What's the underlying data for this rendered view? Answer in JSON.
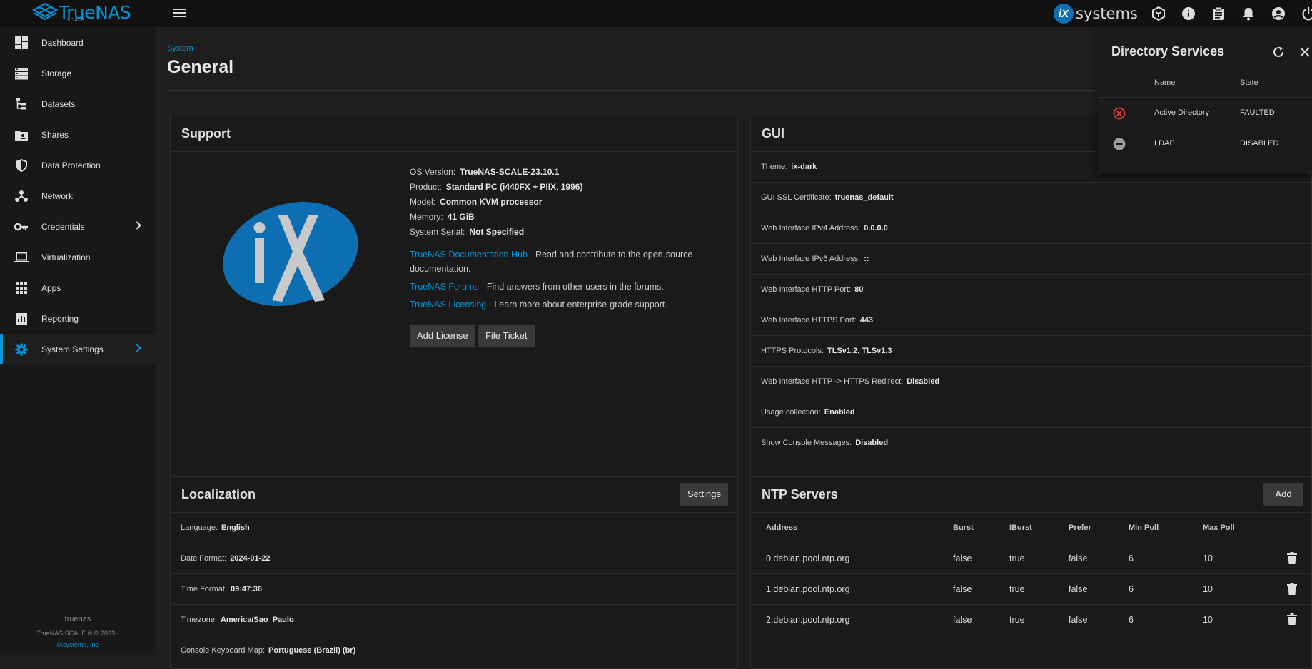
{
  "topbar": {
    "logo_text": "TrueNAS",
    "logo_sub": "SCALE",
    "brand": "systems",
    "brand_mark": "iX"
  },
  "sidebar": {
    "items": [
      {
        "label": "Dashboard",
        "icon": "dashboard-icon"
      },
      {
        "label": "Storage",
        "icon": "storage-icon"
      },
      {
        "label": "Datasets",
        "icon": "datasets-icon"
      },
      {
        "label": "Shares",
        "icon": "shares-icon"
      },
      {
        "label": "Data Protection",
        "icon": "shield-icon"
      },
      {
        "label": "Network",
        "icon": "network-icon"
      },
      {
        "label": "Credentials",
        "icon": "key-icon"
      },
      {
        "label": "Virtualization",
        "icon": "laptop-icon"
      },
      {
        "label": "Apps",
        "icon": "apps-icon"
      },
      {
        "label": "Reporting",
        "icon": "reporting-icon"
      },
      {
        "label": "System Settings",
        "icon": "gear-icon"
      }
    ],
    "user": "truenas",
    "footer_line1": "TrueNAS SCALE ® © 2023 -",
    "footer_line2": "iXsystems, Inc"
  },
  "header": {
    "breadcrumb": "System",
    "title": "General"
  },
  "support": {
    "title": "Support",
    "os_version_label": "OS Version:",
    "os_version": "TrueNAS-SCALE-23.10.1",
    "product_label": "Product:",
    "product": "Standard PC (i440FX + PIIX, 1996)",
    "model_label": "Model:",
    "model": "Common KVM processor",
    "memory_label": "Memory:",
    "memory": "41 GiB",
    "serial_label": "System Serial:",
    "serial": "Not Specified",
    "doc_link": "TrueNAS Documentation Hub",
    "doc_text": " - Read and contribute to the open-source documentation.",
    "forums_link": "TrueNAS Forums",
    "forums_text": " - Find answers from other users in the forums.",
    "licensing_link": "TrueNAS Licensing",
    "licensing_text": " - Learn more about enterprise-grade support.",
    "add_license": "Add License",
    "file_ticket": "File Ticket"
  },
  "gui": {
    "title": "GUI",
    "rows": [
      {
        "label": "Theme:",
        "value": "ix-dark"
      },
      {
        "label": "GUI SSL Certificate:",
        "value": "truenas_default"
      },
      {
        "label": "Web Interface IPv4 Address:",
        "value": "0.0.0.0"
      },
      {
        "label": "Web Interface IPv6 Address:",
        "value": "::"
      },
      {
        "label": "Web Interface HTTP Port:",
        "value": "80"
      },
      {
        "label": "Web Interface HTTPS Port:",
        "value": "443"
      },
      {
        "label": "HTTPS Protocols:",
        "value": "TLSv1.2, TLSv1.3"
      },
      {
        "label": "Web Interface HTTP -> HTTPS Redirect:",
        "value": "Disabled"
      },
      {
        "label": "Usage collection:",
        "value": "Enabled"
      },
      {
        "label": "Show Console Messages:",
        "value": "Disabled"
      }
    ]
  },
  "localization": {
    "title": "Localization",
    "settings": "Settings",
    "rows": [
      {
        "label": "Language:",
        "value": "English"
      },
      {
        "label": "Date Format:",
        "value": "2024-01-22"
      },
      {
        "label": "Time Format:",
        "value": "09:47:36"
      },
      {
        "label": "Timezone:",
        "value": "America/Sao_Paulo"
      },
      {
        "label": "Console Keyboard Map:",
        "value": "Portuguese (Brazil) (br)"
      }
    ]
  },
  "ntp": {
    "title": "NTP Servers",
    "add": "Add",
    "columns": [
      "Address",
      "Burst",
      "IBurst",
      "Prefer",
      "Min Poll",
      "Max Poll"
    ],
    "rows": [
      [
        "0.debian.pool.ntp.org",
        "false",
        "true",
        "false",
        "6",
        "10"
      ],
      [
        "1.debian.pool.ntp.org",
        "false",
        "true",
        "false",
        "6",
        "10"
      ],
      [
        "2.debian.pool.ntp.org",
        "false",
        "true",
        "false",
        "6",
        "10"
      ]
    ]
  },
  "directory_services": {
    "title": "Directory Services",
    "col_name": "Name",
    "col_state": "State",
    "rows": [
      {
        "name": "Active Directory",
        "state": "FAULTED",
        "status_color": "#e53935"
      },
      {
        "name": "LDAP",
        "state": "DISABLED",
        "status_color": "#9e9e9e"
      }
    ]
  }
}
